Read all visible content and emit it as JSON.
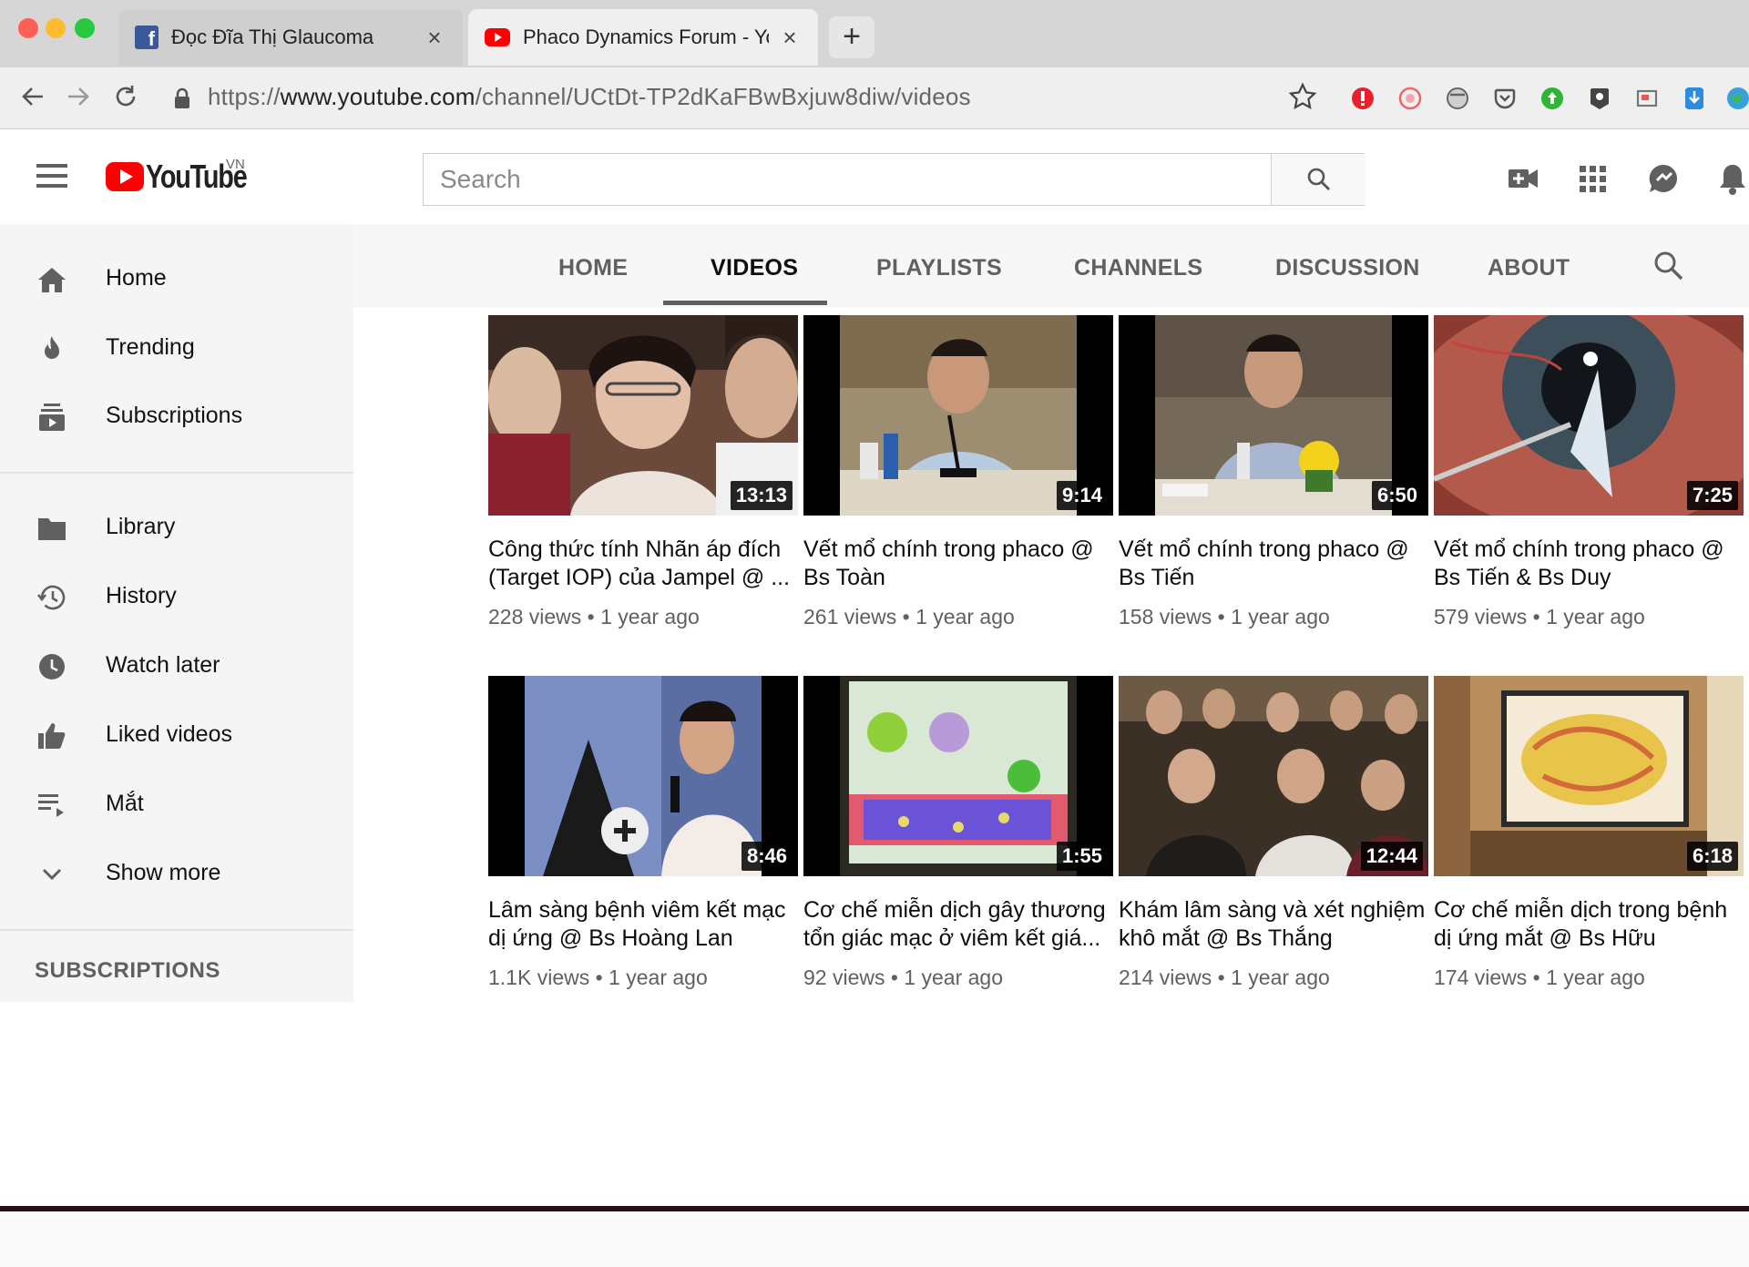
{
  "browser": {
    "tabs": [
      {
        "title": "Đọc Đĩa Thị Glaucoma",
        "favicon": "facebook-icon",
        "active": false
      },
      {
        "title": "Phaco Dynamics Forum - YouT",
        "favicon": "youtube-icon",
        "active": true
      }
    ],
    "new_tab": "+",
    "close_glyph": "×",
    "url_scheme": "https://",
    "url_domain": "www.youtube.com",
    "url_path": "/channel/UCtDt-TP2dKaFBwBxjuw8diw/videos",
    "colors": {
      "tab_strip": "#d6d6d6",
      "toolbar": "#efefef"
    }
  },
  "masthead": {
    "logo_text": "YouTube",
    "country": "VN",
    "search_placeholder": "Search",
    "icons": [
      "create-video-icon",
      "apps-grid-icon",
      "messages-icon",
      "notifications-bell-icon"
    ],
    "brand_color": "#ff0000"
  },
  "sidebar": {
    "items": [
      {
        "label": "Home",
        "icon": "home-icon"
      },
      {
        "label": "Trending",
        "icon": "trending-flame-icon"
      },
      {
        "label": "Subscriptions",
        "icon": "subscriptions-icon"
      },
      {
        "label": "Library",
        "icon": "library-folder-icon"
      },
      {
        "label": "History",
        "icon": "history-icon"
      },
      {
        "label": "Watch later",
        "icon": "watch-later-clock-icon"
      },
      {
        "label": "Liked videos",
        "icon": "thumbs-up-icon"
      },
      {
        "label": "Mắt",
        "icon": "playlist-icon"
      },
      {
        "label": "Show more",
        "icon": "chevron-down-icon"
      }
    ],
    "subscriptions_heading": "SUBSCRIPTIONS"
  },
  "channel_tabs": {
    "tabs": [
      "HOME",
      "VIDEOS",
      "PLAYLISTS",
      "CHANNELS",
      "DISCUSSION",
      "ABOUT"
    ],
    "active": "VIDEOS"
  },
  "videos": [
    {
      "title": "Công thức tính Nhãn áp đích (Target IOP) của Jampel @ ...",
      "meta": "228 views • 1 year ago",
      "duration": "13:13"
    },
    {
      "title": "Vết mổ chính trong phaco @ Bs Toàn",
      "meta": "261 views • 1 year ago",
      "duration": "9:14"
    },
    {
      "title": "Vết mổ chính trong phaco @ Bs Tiến",
      "meta": "158 views • 1 year ago",
      "duration": "6:50"
    },
    {
      "title": "Vết mổ chính trong phaco @ Bs Tiến & Bs Duy",
      "meta": "579 views • 1 year ago",
      "duration": "7:25"
    },
    {
      "title": "Lâm sàng bệnh viêm kết mạc dị ứng @ Bs Hoàng Lan",
      "meta": "1.1K views • 1 year ago",
      "duration": "8:46"
    },
    {
      "title": "Cơ chế miễn dịch gây thương tổn giác mạc ở viêm kết giá...",
      "meta": "92 views • 1 year ago",
      "duration": "1:55"
    },
    {
      "title": "Khám lâm sàng và xét nghiệm khô mắt @ Bs Thắng",
      "meta": "214 views • 1 year ago",
      "duration": "12:44"
    },
    {
      "title": "Cơ chế miễn dịch trong bệnh dị ứng mắt @ Bs Hữu",
      "meta": "174 views • 1 year ago",
      "duration": "6:18"
    },
    {
      "title": "",
      "meta": "",
      "duration": ""
    },
    {
      "title": "",
      "meta": "",
      "duration": ""
    },
    {
      "title": "",
      "meta": "",
      "duration": ""
    },
    {
      "title": "",
      "meta": "",
      "duration": ""
    }
  ]
}
